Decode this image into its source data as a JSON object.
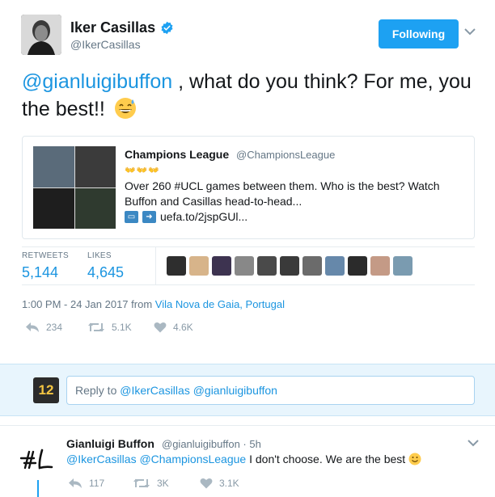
{
  "tweet": {
    "author_name": "Iker Casillas",
    "author_handle": "@IkerCasillas",
    "follow_label": "Following",
    "text_mention": "@gianluigibuffon",
    "text_line": " , what do you think? For me, you the best!!",
    "quote": {
      "name": "Champions League",
      "handle": "@ChampionsLeague",
      "emojis": "👐👐👐",
      "text": "Over 260 #UCL games between them. Who is the best? Watch Buffon and Casillas head-to-head...",
      "link": "uefa.to/2jspGUl..."
    },
    "stats": {
      "retweets_label": "RETWEETS",
      "retweets_value": "5,144",
      "likes_label": "LIKES",
      "likes_value": "4,645"
    },
    "likers": [
      "liker-1",
      "liker-2",
      "liker-3",
      "liker-4",
      "liker-5",
      "liker-6",
      "liker-7",
      "liker-8",
      "liker-9",
      "liker-10",
      "liker-11"
    ],
    "liker_colors": [
      "#2e2e2e",
      "#d7b48a",
      "#3d3350",
      "#888888",
      "#4a4a4a",
      "#3a3a3a",
      "#6b6b6b",
      "#6688aa",
      "#2b2b2b",
      "#c49a86",
      "#7a9bb0"
    ],
    "timestamp": "1:00 PM - 24 Jan 2017 from ",
    "location": "Vila Nova de Gaia, Portugal",
    "actions": {
      "reply_count": "234",
      "retweet_count": "5.1K",
      "like_count": "4.6K"
    }
  },
  "reply_compose": {
    "avatar_text": "12",
    "prefix": "Reply to ",
    "mentions": "@IkerCasillas @gianluigibuffon"
  },
  "reply": {
    "name": "Gianluigi Buffon",
    "meta": "@gianluigibuffon · 5h",
    "mentions": "@IkerCasillas @ChampionsLeague",
    "text": " I don't choose. We are the best",
    "reply_count": "117",
    "retweet_count": "3K",
    "like_count": "3.1K"
  },
  "colors": {
    "accent": "#1da1f2",
    "link": "#1b95e0",
    "muted": "#657786"
  }
}
